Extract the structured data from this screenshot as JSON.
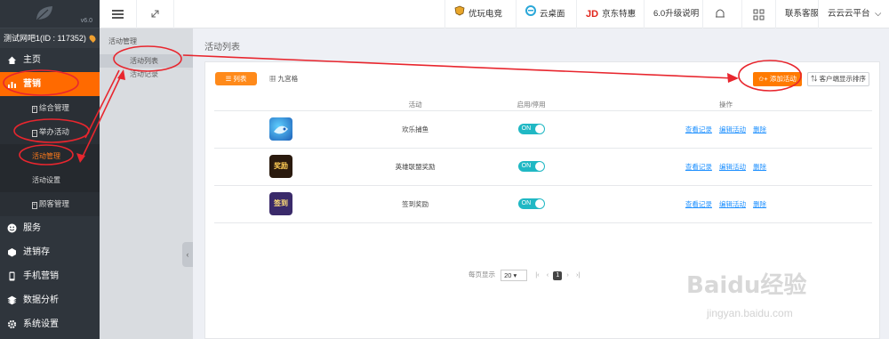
{
  "app": {
    "version": "v6.0",
    "account": "测试网吧1(ID : 117352)"
  },
  "sidebar": {
    "items": [
      {
        "label": "主页",
        "icon": "home-icon"
      },
      {
        "label": "营销",
        "icon": "chart-icon",
        "active": true
      },
      {
        "label": "服务",
        "icon": "smile-icon"
      },
      {
        "label": "进销存",
        "icon": "box-icon"
      },
      {
        "label": "手机营销",
        "icon": "phone-icon"
      },
      {
        "label": "数据分析",
        "icon": "layers-icon"
      },
      {
        "label": "系统设置",
        "icon": "gear-icon"
      }
    ],
    "marketing_sub": [
      {
        "label": "综合管理"
      },
      {
        "label": "举办活动"
      }
    ],
    "activity_sub": [
      {
        "label": "活动管理",
        "active": true
      },
      {
        "label": "活动设置"
      }
    ],
    "customer": {
      "label": "顾客管理"
    }
  },
  "panel2": {
    "title": "活动管理",
    "items": [
      {
        "label": "活动列表"
      },
      {
        "label": "活动记录"
      }
    ]
  },
  "topbar": {
    "links": [
      {
        "label": "优玩电竞",
        "icon": "shield-icon"
      },
      {
        "label": "云桌面",
        "icon": "e-icon"
      },
      {
        "label": "京东特惠",
        "icon": "jd-icon"
      },
      {
        "label": "6.0升级说明"
      }
    ],
    "service": "联系客服",
    "platform": "云云云平台"
  },
  "main": {
    "page_title": "活动列表",
    "tab_list": "列表",
    "tab_grid": "九宫格",
    "add_button": "添加活动",
    "sort_button": "客户端显示排序",
    "columns": [
      "活动",
      "启用/停用",
      "操作"
    ],
    "rows": [
      {
        "name": "欢乐捕鱼",
        "toggle": "ON",
        "thumb_text": ""
      },
      {
        "name": "英雄联盟奖励",
        "toggle": "ON",
        "thumb_text": "奖励"
      },
      {
        "name": "签到奖励",
        "toggle": "ON",
        "thumb_text": "签到"
      }
    ],
    "actions": [
      "查看记录",
      "编辑活动",
      "删除"
    ],
    "pager": {
      "label": "每页显示",
      "page_size": "20",
      "current": "1"
    }
  },
  "watermark": {
    "text": "Baidu经验",
    "url": "jingyan.baidu.com"
  },
  "colors": {
    "accent": "#ff7a00",
    "sidebar_bg": "#2f353c",
    "toggle": "#20b8c4",
    "link": "#1e90ff",
    "annotation": "#e8262e"
  }
}
